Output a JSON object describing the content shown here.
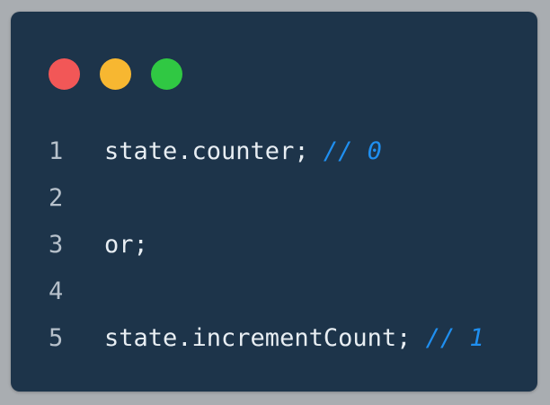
{
  "window": {
    "controls": [
      {
        "name": "close",
        "color": "#f25757"
      },
      {
        "name": "minimize",
        "color": "#f7b731"
      },
      {
        "name": "maximize",
        "color": "#30c843"
      }
    ]
  },
  "code": {
    "lines": [
      {
        "number": "1",
        "code": "state.counter; ",
        "comment": "// 0"
      },
      {
        "number": "2",
        "code": "",
        "comment": ""
      },
      {
        "number": "3",
        "code": "or;",
        "comment": ""
      },
      {
        "number": "4",
        "code": "",
        "comment": ""
      },
      {
        "number": "5",
        "code": "state.incrementCount; ",
        "comment": "// 1"
      }
    ]
  },
  "colors": {
    "background": "#1d344a",
    "text": "#e8eef3",
    "line_number": "#b7c1cb",
    "comment": "#1f8ff0"
  }
}
